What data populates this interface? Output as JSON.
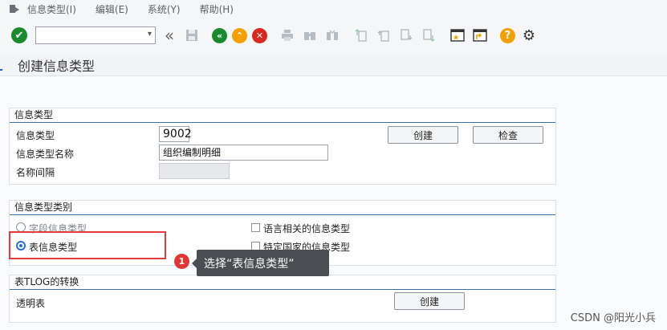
{
  "menu": {
    "items": [
      "信息类型(I)",
      "编辑(E)",
      "系统(Y)",
      "帮助(H)"
    ]
  },
  "toolbar": {
    "command_value": "",
    "icons": [
      "check-icon",
      "back-double-icon",
      "save-icon",
      "nav-back-icon",
      "nav-up-icon",
      "cancel-icon",
      "print-icon",
      "find-icon",
      "find-next-icon",
      "first-page-icon",
      "prev-page-icon",
      "next-page-icon",
      "last-page-icon",
      "new-session-icon",
      "shortcut-icon",
      "help-icon",
      "settings-gear-icon"
    ]
  },
  "page": {
    "title": "创建信息类型"
  },
  "group_infotype": {
    "title": "信息类型",
    "infotype_label": "信息类型",
    "infotype_value": "9002",
    "name_label": "信息类型名称",
    "name_value": "组织编制明细",
    "interval_label": "名称间隔",
    "interval_value": "",
    "create_label": "创建",
    "check_label": "检查"
  },
  "group_category": {
    "title": "信息类型类别",
    "option_field": "字段信息类型",
    "option_table": "表信息类型",
    "option_table_selected": true,
    "option_language": "语言相关的信息类型",
    "option_country": "特定国家的信息类型"
  },
  "group_tlog": {
    "title": "表TLOG的转换",
    "transparent_label": "透明表",
    "create_label": "创建"
  },
  "annotation": {
    "step": "1",
    "text": "选择“表信息类型”"
  },
  "watermark": "CSDN @阳光小兵"
}
